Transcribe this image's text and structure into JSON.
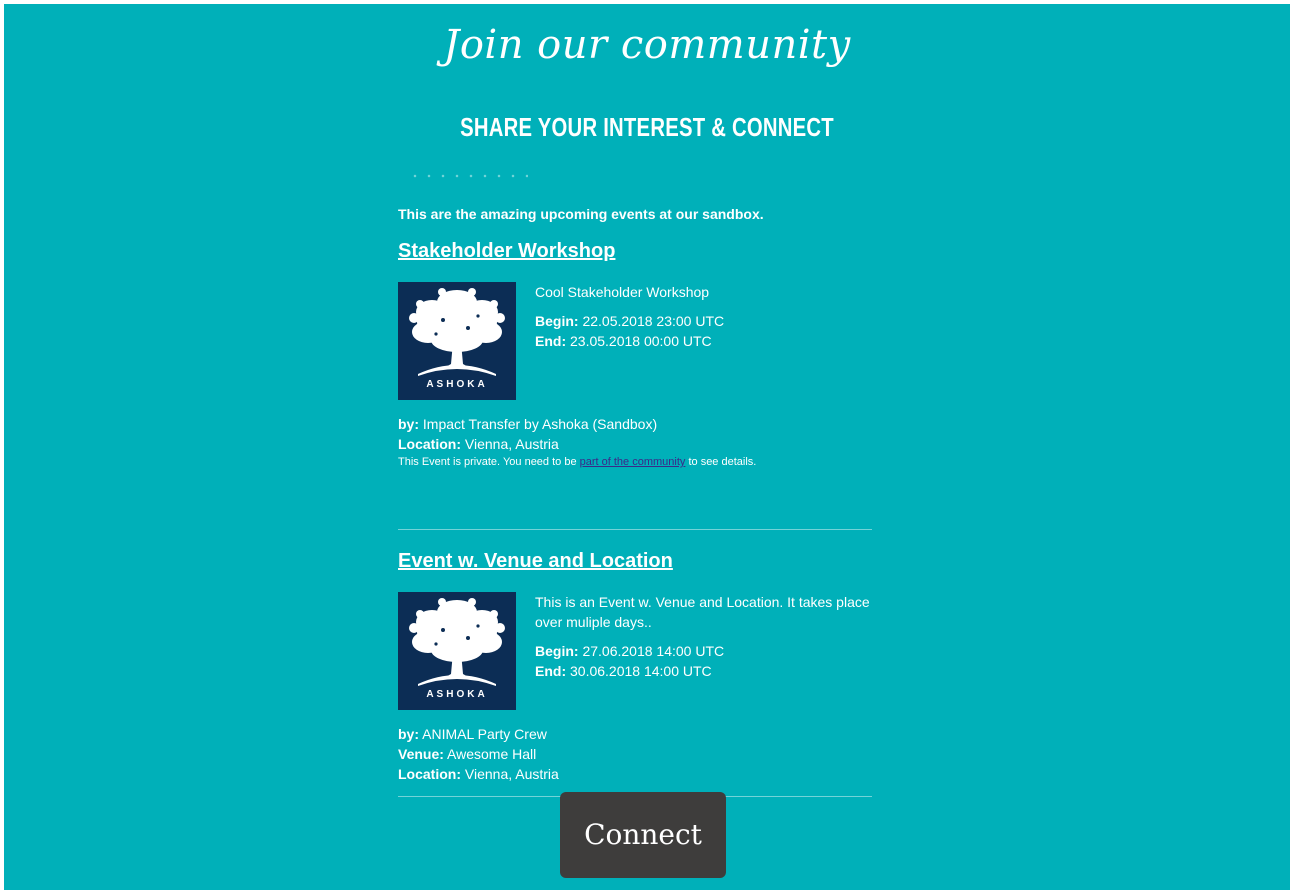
{
  "header": {
    "title": "Join our community",
    "subtitle": "SHARE YOUR INTEREST & CONNECT"
  },
  "intro": "This are the amazing upcoming events at our sandbox.",
  "events": [
    {
      "title": "Stakeholder Workshop",
      "logo_text": "ASHOKA",
      "description": "Cool Stakeholder Workshop",
      "begin_label": "Begin:",
      "begin": " 22.05.2018 23:00 UTC",
      "end_label": "End:",
      "end": " 23.05.2018 00:00 UTC",
      "by_label": "by:",
      "by": " Impact Transfer by Ashoka (Sandbox)",
      "location_label": "Location:",
      "location": " Vienna, Austria",
      "private_prefix": "This Event is private. You need to be ",
      "private_link": "part of the community",
      "private_suffix": " to see details."
    },
    {
      "title": "Event w. Venue and Location",
      "logo_text": "ASHOKA",
      "description": "This is an Event w. Venue and Location. It takes place over muliple days..",
      "begin_label": "Begin:",
      "begin": " 27.06.2018 14:00 UTC",
      "end_label": "End:",
      "end": " 30.06.2018 14:00 UTC",
      "by_label": "by:",
      "by": " ANIMAL Party Crew",
      "venue_label": "Venue:",
      "venue": " Awesome Hall",
      "location_label": "Location:",
      "location": " Vienna, Austria"
    }
  ],
  "connect_button": "Connect",
  "colors": {
    "background": "#00b0b9",
    "logo_background": "#0c2d55",
    "button": "#3e3d3c",
    "link": "#3a2a8a"
  }
}
